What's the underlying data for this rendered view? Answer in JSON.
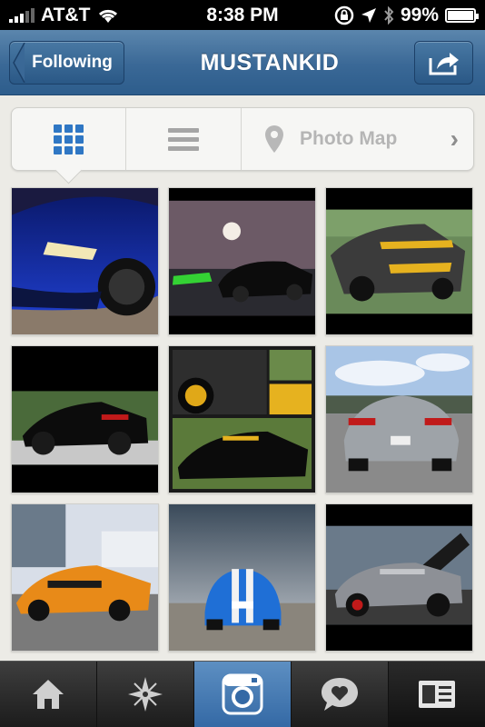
{
  "status_bar": {
    "carrier": "AT&T",
    "time": "8:38 PM",
    "battery_percent": "99%",
    "battery_level": 0.99
  },
  "nav": {
    "back_label": "Following",
    "title": "MUSTANKID"
  },
  "view_switcher": {
    "photo_map_label": "Photo Map",
    "selected": "grid"
  },
  "photos": [
    {
      "name": "photo-blue-mustang-closeup"
    },
    {
      "name": "photo-black-mustang-night"
    },
    {
      "name": "photo-gray-mustang-track"
    },
    {
      "name": "photo-black-mustang-side"
    },
    {
      "name": "photo-black-yellow-collage"
    },
    {
      "name": "photo-silver-mustang-rear"
    },
    {
      "name": "photo-orange-mustang-event"
    },
    {
      "name": "photo-blue-shelby-front"
    },
    {
      "name": "photo-silver-shelby-hood-open"
    }
  ],
  "tabs": [
    {
      "icon": "home-icon"
    },
    {
      "icon": "explore-icon"
    },
    {
      "icon": "camera-icon",
      "active": true
    },
    {
      "icon": "activity-icon"
    },
    {
      "icon": "profile-icon"
    }
  ],
  "colors": {
    "nav_blue": "#3a6896",
    "active_tab": "#3469a5",
    "grid_icon_blue": "#2f77c4"
  }
}
